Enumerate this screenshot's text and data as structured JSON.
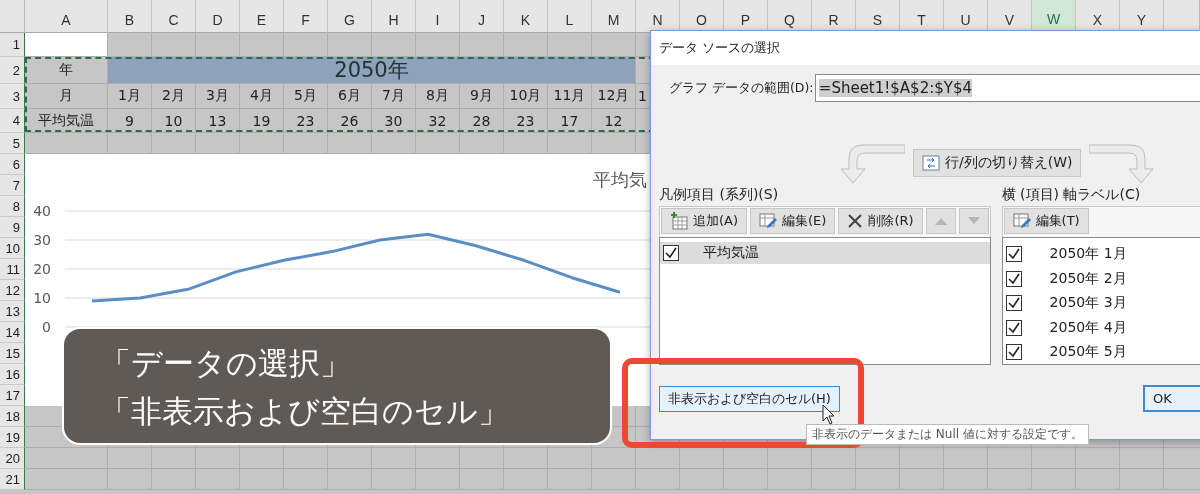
{
  "columns": [
    {
      "label": "A",
      "selected": false
    },
    {
      "label": "B",
      "selected": false
    },
    {
      "label": "C",
      "selected": false
    },
    {
      "label": "D",
      "selected": false
    },
    {
      "label": "E",
      "selected": false
    },
    {
      "label": "F",
      "selected": false
    },
    {
      "label": "G",
      "selected": false
    },
    {
      "label": "H",
      "selected": false
    },
    {
      "label": "I",
      "selected": false
    },
    {
      "label": "J",
      "selected": false
    },
    {
      "label": "K",
      "selected": false
    },
    {
      "label": "L",
      "selected": false
    },
    {
      "label": "M",
      "selected": false
    },
    {
      "label": "N",
      "selected": false
    },
    {
      "label": "O",
      "selected": false
    },
    {
      "label": "P",
      "selected": false
    },
    {
      "label": "Q",
      "selected": false
    },
    {
      "label": "R",
      "selected": false
    },
    {
      "label": "S",
      "selected": false
    },
    {
      "label": "T",
      "selected": false
    },
    {
      "label": "U",
      "selected": false
    },
    {
      "label": "V",
      "selected": false
    },
    {
      "label": "W",
      "selected": true
    },
    {
      "label": "X",
      "selected": false
    },
    {
      "label": "Y",
      "selected": false
    }
  ],
  "rows": [
    "1",
    "2",
    "3",
    "4",
    "5",
    "6",
    "7",
    "8",
    "9",
    "10",
    "11",
    "12",
    "13",
    "14",
    "15",
    "16",
    "17",
    "18",
    "19",
    "20",
    "21"
  ],
  "table": {
    "row_2": {
      "header": "年",
      "merged": "2050年"
    },
    "row_3": {
      "header": "月",
      "values": [
        "1月",
        "2月",
        "3月",
        "4月",
        "5月",
        "6月",
        "7月",
        "8月",
        "9月",
        "10月",
        "11月",
        "12月",
        "1"
      ]
    },
    "row_4": {
      "header": "平均気温",
      "values": [
        "9",
        "10",
        "13",
        "19",
        "23",
        "26",
        "30",
        "32",
        "28",
        "23",
        "17",
        "12"
      ]
    }
  },
  "chart": {
    "chart_data": {
      "type": "line",
      "title": "平均気",
      "ylim": [
        0,
        40
      ],
      "yticks": [
        0,
        10,
        20,
        30,
        40
      ],
      "grid": true,
      "series": [
        {
          "color": "#5b8ec4",
          "values": [
            9,
            10,
            13,
            19,
            23,
            26,
            30,
            32,
            28,
            23,
            17,
            12
          ]
        }
      ]
    }
  },
  "dialog": {
    "title": "データ ソースの選択",
    "range_label": "グラフ データの範囲(D):",
    "range_field": {
      "value": "=Sheet1!$A$2:$Y$4",
      "selected": true
    },
    "switch_button": "行/列の切り替え(W)",
    "legend": {
      "label": "凡例項目 (系列)(S)",
      "buttons": [
        {
          "kind": "add",
          "label": "追加(A)",
          "disabled": false
        },
        {
          "kind": "edit",
          "label": "編集(E)",
          "disabled": false
        },
        {
          "kind": "delete",
          "label": "削除(R)",
          "disabled": false
        },
        {
          "kind": "up",
          "disabled": true
        },
        {
          "kind": "down",
          "disabled": true
        }
      ],
      "items": [
        {
          "label": "平均気温",
          "checked": true,
          "selected": true
        }
      ]
    },
    "axis": {
      "label": "横 (項目) 軸ラベル(C)",
      "edit_button": "編集(T)",
      "items": [
        {
          "label": "2050年 1月",
          "checked": true
        },
        {
          "label": "2050年 2月",
          "checked": true
        },
        {
          "label": "2050年 3月",
          "checked": true
        },
        {
          "label": "2050年 4月",
          "checked": true
        },
        {
          "label": "2050年 5月",
          "checked": true
        }
      ]
    },
    "hidden_cells_button": "非表示および空白のセル(H)",
    "ok_button": "OK"
  },
  "tooltip": "非表示のデータまたは Null 値に対する設定です。",
  "caption": {
    "lines": [
      "「データの選択」",
      "「非表示および空白のセル」"
    ]
  }
}
